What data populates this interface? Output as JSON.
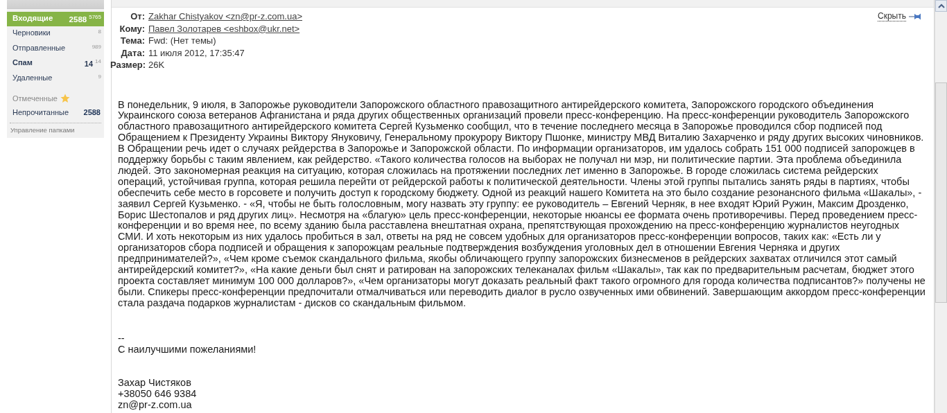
{
  "sidebar": {
    "folders": [
      {
        "label": "Входящие",
        "unread": "2588",
        "total": "5765",
        "selected": true
      },
      {
        "label": "Черновики",
        "total": "8",
        "selected": false
      },
      {
        "label": "Отправленные",
        "total": "989",
        "selected": false
      },
      {
        "label": "Спам",
        "unread": "14",
        "total": "14",
        "selected": false
      },
      {
        "label": "Удаленные",
        "total": "9",
        "selected": false
      }
    ],
    "filters": [
      {
        "label": "Отмеченные",
        "kind": "starred"
      },
      {
        "label": "Непрочитанные",
        "kind": "count",
        "count": "2588"
      }
    ],
    "manage_link": "Управление папками"
  },
  "message": {
    "hide_link": "Скрыть",
    "headers": [
      {
        "label": "От:",
        "value": "Zakhar Chistyakov <zn@pr-z.com.ua>",
        "kind": "link"
      },
      {
        "label": "Кому:",
        "value": "Павел Золотарев <eshbox@ukr.net>",
        "kind": "link"
      },
      {
        "label": "Тема:",
        "value": "Fwd: (Нет темы)",
        "kind": "text"
      },
      {
        "label": "Дата:",
        "value": "11 июля 2012, 17:35:47",
        "kind": "text"
      },
      {
        "label": "Размер:",
        "value": "26K",
        "kind": "text"
      }
    ],
    "body": "В понедельник, 9 июля, в Запорожье руководители Запорожского областного правозащитного антирейдерского комитета, Запорожского городского объединения Украинского союза ветеранов Афганистана и ряда других общественных организаций провели пресс-конференцию. На пресс-конференции руководитель Запорожского областного правозащитного антирейдерского комитета Сергей Кузьменко сообщил, что в течение последнего месяца в Запорожье проводился сбор подписей под Обращением к Президенту Украины Виктору Януковичу, Генеральному прокурору Виктору Пшонке, министру МВД Виталию Захарченко и ряду других высоких чиновников. В Обращении речь идет о случаях рейдерства в Запорожье и Запорожской области. По информации организаторов, им удалось собрать 151 000 подписей запорожцев в поддержку борьбы с таким явлением, как рейдерство. «Такого количества голосов на выборах не получал ни мэр, ни политические партии. Эта проблема объединила людей. Это закономерная реакция на ситуацию, которая сложилась на протяжении последних лет именно в Запорожье. В городе сложилась система рейдерских операций, устойчивая группа, которая решила перейти от рейдерской работы к политической деятельности. Члены этой группы пытались занять ряды в партиях, чтобы обеспечить себе место в горсовете и получить доступ к городскому бюджету. Одной из реакций нашего Комитета на это было создание резонансного фильма «Шакалы», - заявил Сергей Кузьменко. - «Я, чтобы не быть голословным, могу назвать эту группу: ее руководитель – Евгений Черняк, в нее входят Юрий Ружин, Максим Дрозденко, Борис Шестопалов и ряд других лиц». Несмотря на «благую» цель пресс-конференции, некоторые нюансы ее формата очень противоречивы. Перед проведением пресс-конференции и во время нее, по всему зданию была расставлена внештатная охрана, препятствующая прохождению на пресс-конференцию журналистов неугодных СМИ. И хоть некоторым из них удалось пробиться в зал, ответы на ряд не совсем удобных для организаторов пресс-конференции вопросов, таких как: «Есть ли у организаторов сбора подписей и обращения к запорожцам реальные подтверждения возбуждения уголовных дел в отношении Евгения Черняка и других предпринимателей?», «Чем кроме съемок скандального фильма, якобы обличающего группу запорожских бизнесменов в рейдерских захватах отличился этот самый антирейдерский комитет?», «На какие деньги был снят и ратирован на запорожских телеканалах фильм «Шакалы», так как по предварительным расчетам, бюджет этого проекта составляет минимум 100 000 долларов?», «Чем организаторы могут доказать реальный факт такого огромного для города количества подписантов?» получены не были. Спикеры пресс-конференции предпочитали отмалчиваться или переводить диалог в русло озвученных ими обвинений. Завершающим аккордом пресс-конференции стала раздача подарков журналистам - дисков со скандальным фильмом.",
    "signature": {
      "separator": "--",
      "greeting": "С наилучшими пожеланиями!",
      "lines": [
        "Захар Чистяков",
        "+38050 646 9384",
        "zn@pr-z.com.ua"
      ]
    }
  }
}
